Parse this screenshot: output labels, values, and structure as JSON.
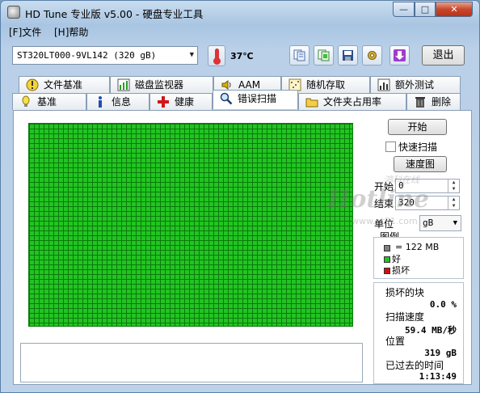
{
  "window": {
    "title": "HD Tune 专业版 v5.00 - 硬盘专业工具",
    "controls": {
      "minimize": "—",
      "maximize": "□",
      "close": "✕"
    }
  },
  "menu": [
    {
      "label": "[F]文件"
    },
    {
      "label": "[H]帮助"
    }
  ],
  "toolbar": {
    "drive": "ST320LT000-9VL142 (320 gB)",
    "temperature": "37℃",
    "buttons": [
      {
        "icon": "copy-text-icon"
      },
      {
        "icon": "copy-screenshot-icon"
      },
      {
        "icon": "save-icon"
      },
      {
        "icon": "options-icon"
      },
      {
        "icon": "download-icon"
      }
    ],
    "exit_label": "退出"
  },
  "tabs": {
    "top_row": [
      {
        "label": "文件基准",
        "icon": "file-benchmark-icon"
      },
      {
        "label": "磁盘监视器",
        "icon": "disk-monitor-icon"
      },
      {
        "label": "AAM",
        "icon": "speaker-icon"
      },
      {
        "label": "随机存取",
        "icon": "random-access-icon"
      },
      {
        "label": "额外测试",
        "icon": "extra-tests-icon"
      }
    ],
    "bottom_row": [
      {
        "label": "基准",
        "icon": "benchmark-icon"
      },
      {
        "label": "信息",
        "icon": "info-icon"
      },
      {
        "label": "健康",
        "icon": "health-icon"
      },
      {
        "label": "错误扫描",
        "icon": "error-scan-icon",
        "active": true
      },
      {
        "label": "文件夹占用率",
        "icon": "folder-icon"
      },
      {
        "label": "删除",
        "icon": "trash-icon"
      }
    ]
  },
  "scan": {
    "start_button": "开始",
    "quick_scan_label": "快速扫描",
    "quick_scan_checked": false,
    "speed_map_button": "速度图",
    "start_label": "开始",
    "start_value": "0",
    "end_label": "结束",
    "end_value": "320",
    "unit_label": "单位",
    "unit_value": "gB",
    "legend_title": "图例",
    "legend": [
      {
        "label": "= 122 MB",
        "color": "#808080"
      },
      {
        "label": "好",
        "color": "#22c422"
      },
      {
        "label": "损坏",
        "color": "#d01010"
      }
    ],
    "block_status": "all-good",
    "stats": {
      "damaged_label": "损坏的块",
      "damaged_value": "0.0 %",
      "speed_label": "扫描速度",
      "speed_value": "59.4 MB/秒",
      "position_label": "位置",
      "position_value": "319 gB",
      "elapsed_label": "已过去的时间",
      "elapsed_value": "1:13:49"
    }
  },
  "watermark": {
    "script": "Hotline",
    "cn": "鸿科在线",
    "url": "www.nt91.com"
  },
  "colors": {
    "good_block": "#22c422",
    "grid_line": "#0b7a0b",
    "damaged_block": "#d01010"
  }
}
